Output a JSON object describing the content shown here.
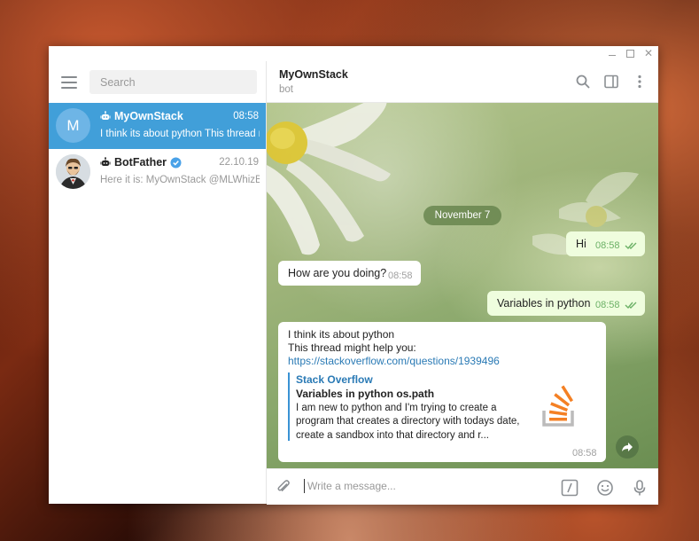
{
  "window": {
    "controls": [
      "minimize",
      "maximize",
      "close"
    ]
  },
  "sidebar": {
    "search_placeholder": "Search",
    "chats": [
      {
        "initial": "M",
        "name": "MyOwnStack",
        "time": "08:58",
        "preview": "I think its about python This thread might help you...",
        "bot": true,
        "selected": true
      },
      {
        "name": "BotFather",
        "time": "22.10.19",
        "preview": "Here it is: MyOwnStack @MLWhizBot...",
        "bot": true,
        "verified": true,
        "selected": false
      }
    ]
  },
  "header": {
    "title": "MyOwnStack",
    "subtitle": "bot"
  },
  "messages": {
    "date": "November 7",
    "items": [
      {
        "direction": "out",
        "text": "Hi",
        "time": "08:58"
      },
      {
        "direction": "in",
        "text": "How are you doing?",
        "time": "08:58"
      },
      {
        "direction": "out",
        "text": "Variables in python",
        "time": "08:58"
      }
    ],
    "rich": {
      "line1": "I think its about python",
      "line2": "This thread might help you:",
      "link": "https://stackoverflow.com/questions/1939496",
      "preview_site": "Stack Overflow",
      "preview_title": "Variables in python os.path",
      "preview_desc": "I am new to python and I'm trying to create a program that creates a directory with todays date, create a sandbox into that directory and r...",
      "time": "08:58"
    }
  },
  "composer": {
    "placeholder": "Write a message..."
  },
  "colors": {
    "accent": "#419fd9",
    "outgoing_bubble": "#effdde",
    "check": "#6cb166"
  }
}
